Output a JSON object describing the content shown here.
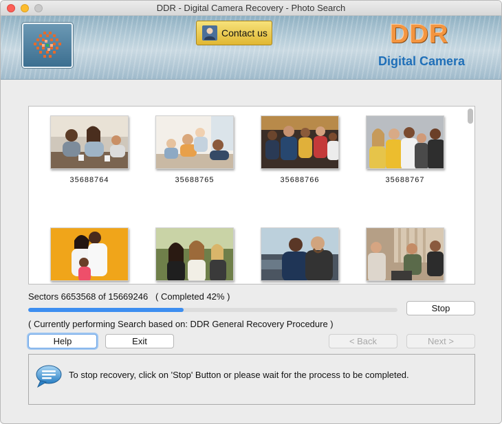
{
  "window": {
    "title": "DDR - Digital Camera Recovery - Photo Search"
  },
  "banner": {
    "contact_label": "Contact us",
    "brand": "DDR",
    "brand_sub": "Digital Camera",
    "icons": {
      "logo": "recovery-logo-icon",
      "contact": "person-icon"
    }
  },
  "gallery": {
    "items": [
      {
        "label": "35688764",
        "scene": "friends-cafe"
      },
      {
        "label": "35688765",
        "scene": "family-living-room"
      },
      {
        "label": "35688766",
        "scene": "group-gathering"
      },
      {
        "label": "35688767",
        "scene": "women-laughing"
      },
      {
        "label": "",
        "scene": "family-yellow-wall"
      },
      {
        "label": "",
        "scene": "friends-outdoor"
      },
      {
        "label": "",
        "scene": "friends-car"
      },
      {
        "label": "",
        "scene": "people-talking"
      }
    ]
  },
  "progress": {
    "sectors_text": "Sectors 6653568 of 15669246   ( Completed 42% )",
    "percent": 42,
    "status_text": "( Currently performing Search based on: DDR General Recovery Procedure )",
    "stop_label": "Stop"
  },
  "buttons": {
    "help": "Help",
    "exit": "Exit",
    "back": "< Back",
    "next": "Next >"
  },
  "info": {
    "icon": "speech-bubble-icon",
    "text": "To stop recovery, click on 'Stop' Button or please wait for the process to be completed."
  },
  "colors": {
    "accent": "#3d8ef0",
    "brand": "#f39540",
    "brand_sub": "#1f6fb8"
  }
}
